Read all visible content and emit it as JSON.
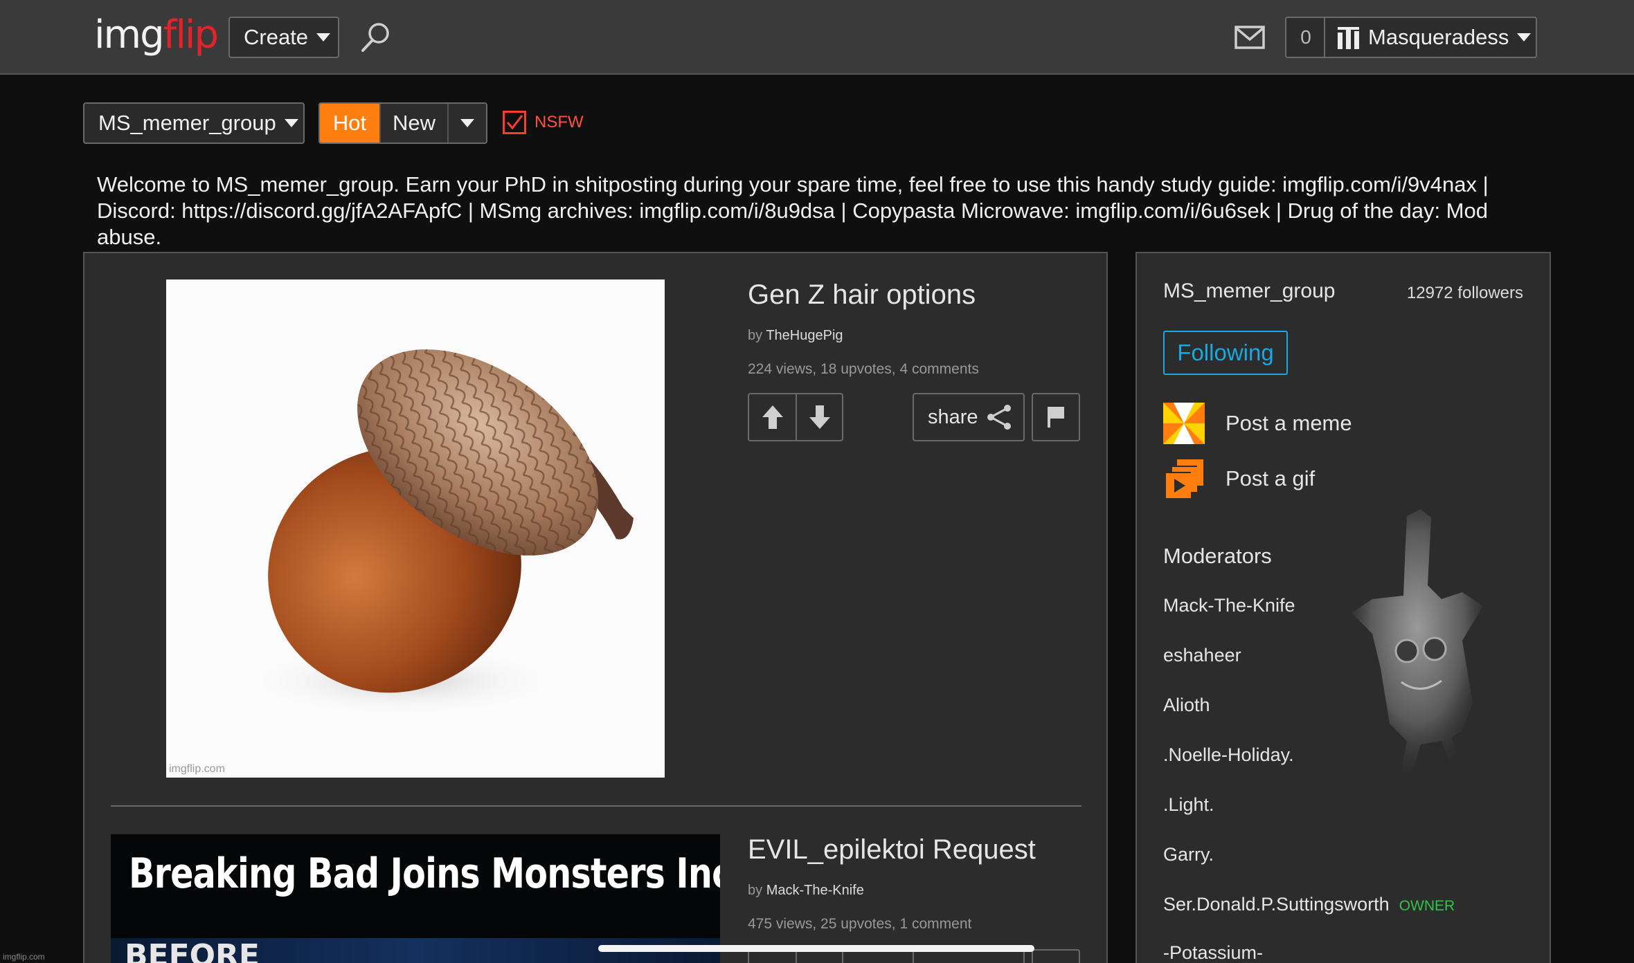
{
  "header": {
    "logo_part1": "img",
    "logo_part2": "flip",
    "create_label": "Create",
    "notif_count": "0",
    "username": "Masqueradess"
  },
  "filters": {
    "group": "MS_memer_group",
    "sort_hot": "Hot",
    "sort_new": "New",
    "nsfw_label": "NSFW",
    "nsfw_checked": true
  },
  "description": "Welcome to MS_memer_group. Earn your PhD in shitposting during your spare time, feel free to use this handy study guide: imgflip.com/i/9v4nax | Discord: https://discord.gg/jfA2AFApfC | MSmg archives: imgflip.com/i/8u9dsa | Copypasta Microwave: imgflip.com/i/6u6sek | Drug of the day: Mod abuse.",
  "posts": [
    {
      "title": "Gen Z hair options",
      "by_prefix": "by ",
      "author": "TheHugePig",
      "stats": "224 views, 18 upvotes, 4 comments",
      "share_label": "share",
      "watermark": "imgflip.com"
    },
    {
      "title": "EVIL_epilektoi Request",
      "by_prefix": "by ",
      "author": "Mack-The-Knife",
      "stats": "475 views, 25 upvotes, 1 comment",
      "caption": "Breaking Bad Joins Monsters Inc",
      "subcaption": "BEFORE"
    }
  ],
  "sidebar": {
    "group_name": "MS_memer_group",
    "followers": "12972 followers",
    "following_label": "Following",
    "post_meme": "Post a meme",
    "post_gif": "Post a gif",
    "moderators_title": "Moderators",
    "moderators": [
      {
        "name": "Mack-The-Knife"
      },
      {
        "name": "eshaheer"
      },
      {
        "name": "Alioth"
      },
      {
        "name": ".Noelle-Holiday."
      },
      {
        "name": ".Light."
      },
      {
        "name": "Garry."
      },
      {
        "name": "Ser.Donald.P.Suttingsworth",
        "badge": "OWNER"
      },
      {
        "name": "-Potassium-"
      }
    ]
  },
  "corner_watermark": "imgflip.com",
  "colors": {
    "accent_orange": "#ff7e0f",
    "logo_red": "#e3232c",
    "following_blue": "#1aa8e0",
    "owner_green": "#33c24a",
    "nsfw_red": "#ff3b30"
  }
}
